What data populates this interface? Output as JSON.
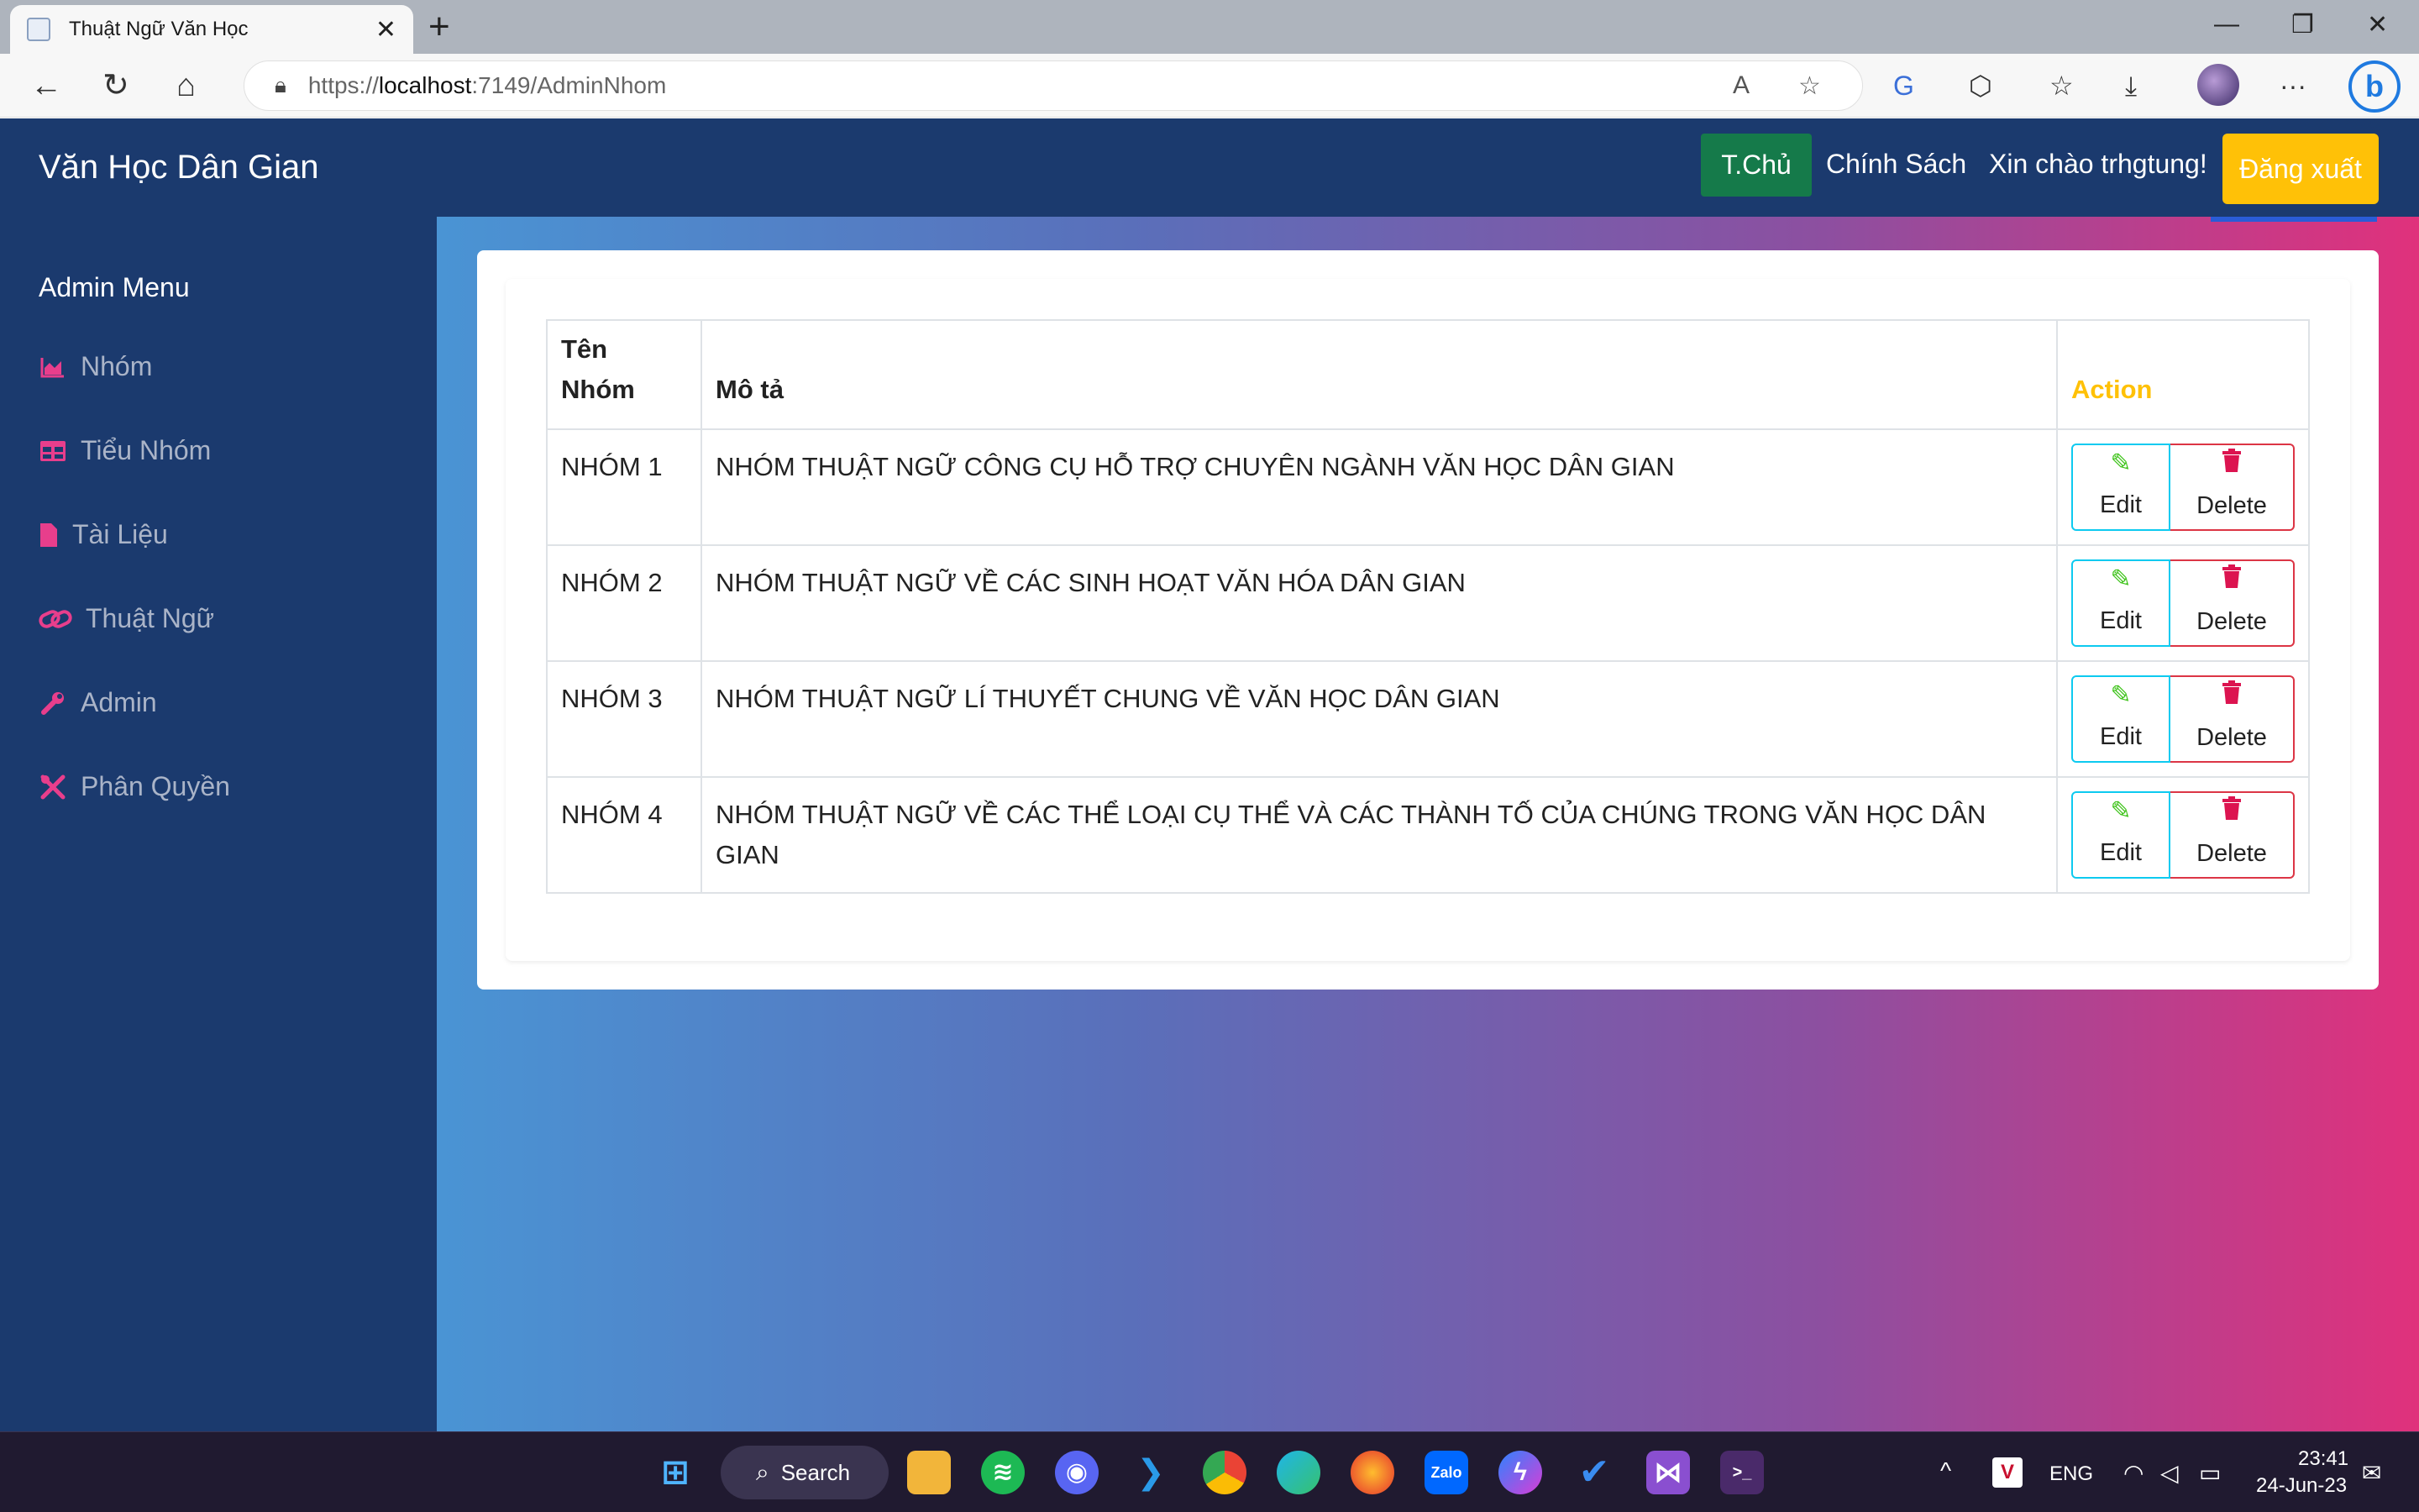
{
  "browser": {
    "tab_title": "Thuật Ngữ Văn Học",
    "tab_close": "✕",
    "new_tab": "+",
    "url_prefix": "https://",
    "url_host": "localhost",
    "url_rest": ":7149/AdminNhom"
  },
  "header": {
    "brand": "Văn Học Dân Gian",
    "home_label": "T.Chủ",
    "policy_label": "Chính Sách",
    "greeting": "Xin chào trhgtung!",
    "logout_label": "Đăng xuất"
  },
  "sidebar": {
    "title": "Admin Menu",
    "items": [
      {
        "label": "Nhóm",
        "icon": "chart-area-icon"
      },
      {
        "label": "Tiểu Nhóm",
        "icon": "table-icon"
      },
      {
        "label": "Tài Liệu",
        "icon": "file-icon"
      },
      {
        "label": "Thuật Ngữ",
        "icon": "link-icon"
      },
      {
        "label": "Admin",
        "icon": "wrench-icon"
      },
      {
        "label": "Phân Quyền",
        "icon": "tools-icon"
      }
    ]
  },
  "table": {
    "headers": {
      "name": "Tên Nhóm",
      "desc": "Mô tả",
      "action": "Action"
    },
    "rows": [
      {
        "name": "NHÓM 1",
        "desc": "NHÓM THUẬT NGỮ CÔNG CỤ HỖ TRỢ CHUYÊN NGÀNH VĂN HỌC DÂN GIAN"
      },
      {
        "name": "NHÓM 2",
        "desc": "NHÓM THUẬT NGỮ VỀ CÁC SINH HOẠT VĂN HÓA DÂN GIAN"
      },
      {
        "name": "NHÓM 3",
        "desc": "NHÓM THUẬT NGỮ LÍ THUYẾT CHUNG VỀ VĂN HỌC DÂN GIAN"
      },
      {
        "name": "NHÓM 4",
        "desc": "NHÓM THUẬT NGỮ VỀ CÁC THỂ LOẠI CỤ THỂ VÀ CÁC THÀNH TỐ CỦA CHÚNG TRONG VĂN HỌC DÂN GIAN"
      }
    ],
    "edit_label": "Edit",
    "delete_label": "Delete"
  },
  "taskbar": {
    "search_label": "Search",
    "language": "ENG",
    "time": "23:41",
    "date": "24-Jun-23"
  },
  "colors": {
    "header_bg": "#1b3a6e",
    "home_btn": "#157a4a",
    "logout_btn": "#ffc107",
    "sidebar_icon": "#e83e8c",
    "action_header": "#ffc107",
    "edit_border": "#0dcaf0",
    "delete_border": "#dc3545"
  }
}
